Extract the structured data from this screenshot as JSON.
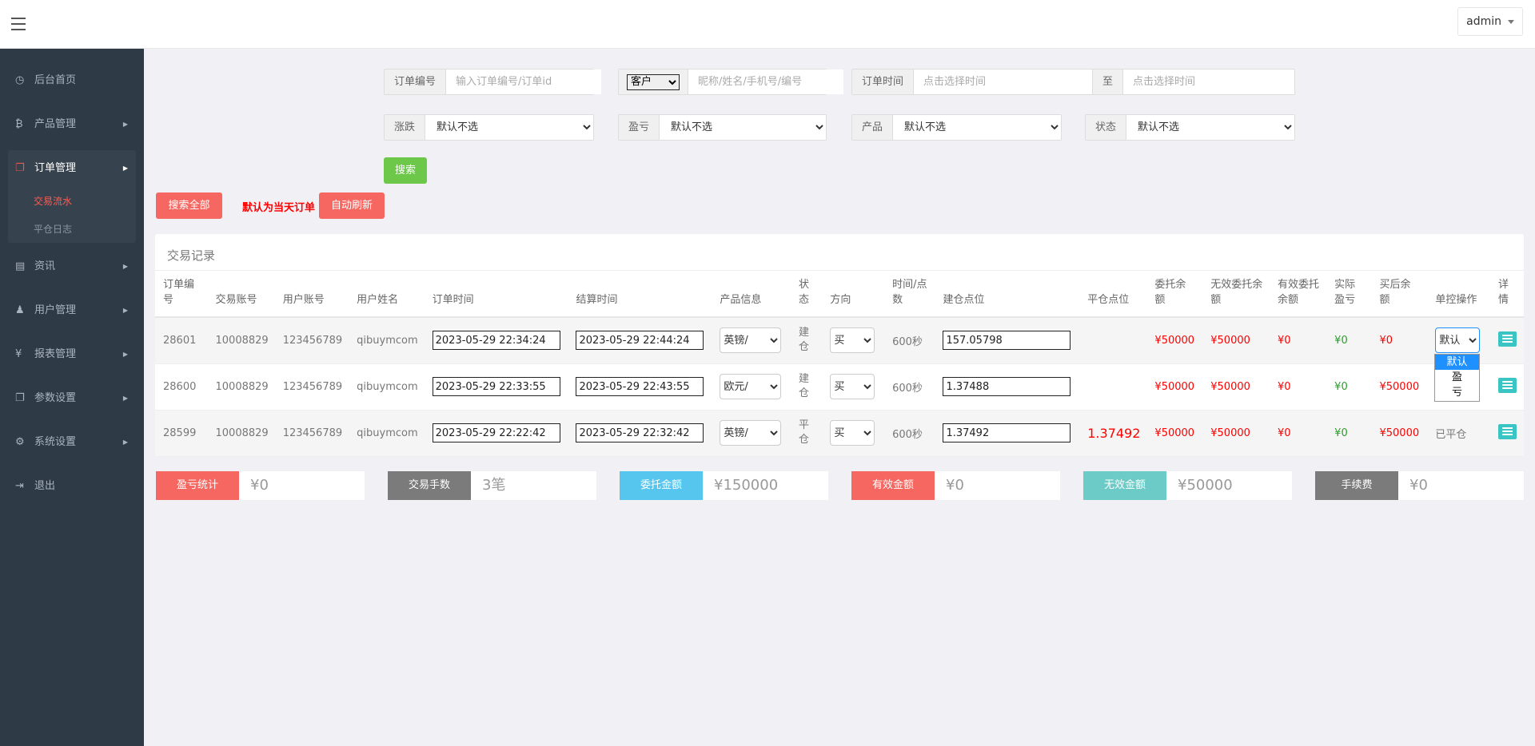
{
  "header": {
    "user": "admin"
  },
  "sidebar": {
    "items": [
      {
        "label": "后台首页",
        "icon": "dashboard-icon"
      },
      {
        "label": "产品管理",
        "icon": "bitcoin-icon"
      },
      {
        "label": "订单管理",
        "icon": "copy-icon"
      },
      {
        "label": "资讯",
        "icon": "news-icon"
      },
      {
        "label": "用户管理",
        "icon": "user-icon"
      },
      {
        "label": "报表管理",
        "icon": "yen-icon"
      },
      {
        "label": "参数设置",
        "icon": "params-icon"
      },
      {
        "label": "系统设置",
        "icon": "gears-icon"
      },
      {
        "label": "退出",
        "icon": "logout-icon"
      }
    ],
    "sub_items": [
      {
        "label": "交易流水"
      },
      {
        "label": "平仓日志"
      }
    ]
  },
  "filters": {
    "order_no_label": "订单编号",
    "order_no_placeholder": "输入订单编号/订单id",
    "customer_select": "客户",
    "customer_placeholder": "昵称/姓名/手机号/编号",
    "time_label": "订单时间",
    "time_placeholder": "点击选择时间",
    "to_label": "至",
    "time2_placeholder": "点击选择时间",
    "rise_label": "涨跌",
    "profit_label": "盈亏",
    "product_label": "产品",
    "status_label": "状态",
    "default_option": "默认不选",
    "search_button": "搜索"
  },
  "toolbar": {
    "search_all": "搜索全部",
    "today_note": "默认为当天订单",
    "auto_refresh": "自动刷新"
  },
  "table": {
    "title": "交易记录",
    "headers": [
      "订单编号",
      "交易账号",
      "用户账号",
      "用户姓名",
      "订单时间",
      "结算时间",
      "产品信息",
      "状态",
      "方向",
      "时间/点数",
      "建仓点位",
      "平仓点位",
      "委托余额",
      "无效委托余额",
      "有效委托余额",
      "实际盈亏",
      "买后余额",
      "单控操作",
      "详情"
    ],
    "rows": [
      {
        "id": "28601",
        "account": "10008829",
        "user": "123456789",
        "name": "qibuymcom",
        "order_time": "2023-05-29 22:34:24",
        "settle_time": "2023-05-29 22:44:24",
        "product": "英镑/",
        "status": "建仓",
        "direction": "买",
        "duration": "600秒",
        "open_price": "157.05798",
        "close_price": "",
        "entrust": "¥50000",
        "invalid": "¥50000",
        "valid": "¥0",
        "profit": "¥0",
        "after": "¥0",
        "control": "默认"
      },
      {
        "id": "28600",
        "account": "10008829",
        "user": "123456789",
        "name": "qibuymcom",
        "order_time": "2023-05-29 22:33:55",
        "settle_time": "2023-05-29 22:43:55",
        "product": "欧元/",
        "status": "建仓",
        "direction": "买",
        "duration": "600秒",
        "open_price": "1.37488",
        "close_price": "",
        "entrust": "¥50000",
        "invalid": "¥50000",
        "valid": "¥0",
        "profit": "¥0",
        "after": "¥50000",
        "control": ""
      },
      {
        "id": "28599",
        "account": "10008829",
        "user": "123456789",
        "name": "qibuymcom",
        "order_time": "2023-05-29 22:22:42",
        "settle_time": "2023-05-29 22:32:42",
        "product": "英镑/",
        "status": "平仓",
        "direction": "买",
        "duration": "600秒",
        "open_price": "1.37492",
        "close_price": "1.37492",
        "entrust": "¥50000",
        "invalid": "¥50000",
        "valid": "¥0",
        "profit": "¥0",
        "after": "¥50000",
        "control": "已平仓"
      }
    ],
    "dropdown_options": [
      "默认",
      "盈",
      "亏"
    ]
  },
  "stats": [
    {
      "label": "盈亏统计",
      "value": "¥0",
      "color": "#f56760"
    },
    {
      "label": "交易手数",
      "value": "3笔",
      "color": "#7b7b7b"
    },
    {
      "label": "委托金额",
      "value": "¥150000",
      "color": "#56c6ee"
    },
    {
      "label": "有效金额",
      "value": "¥0",
      "color": "#f56760"
    },
    {
      "label": "无效金额",
      "value": "¥50000",
      "color": "#6ccbc6"
    },
    {
      "label": "手续费",
      "value": "¥0",
      "color": "#7b7b7b"
    }
  ]
}
